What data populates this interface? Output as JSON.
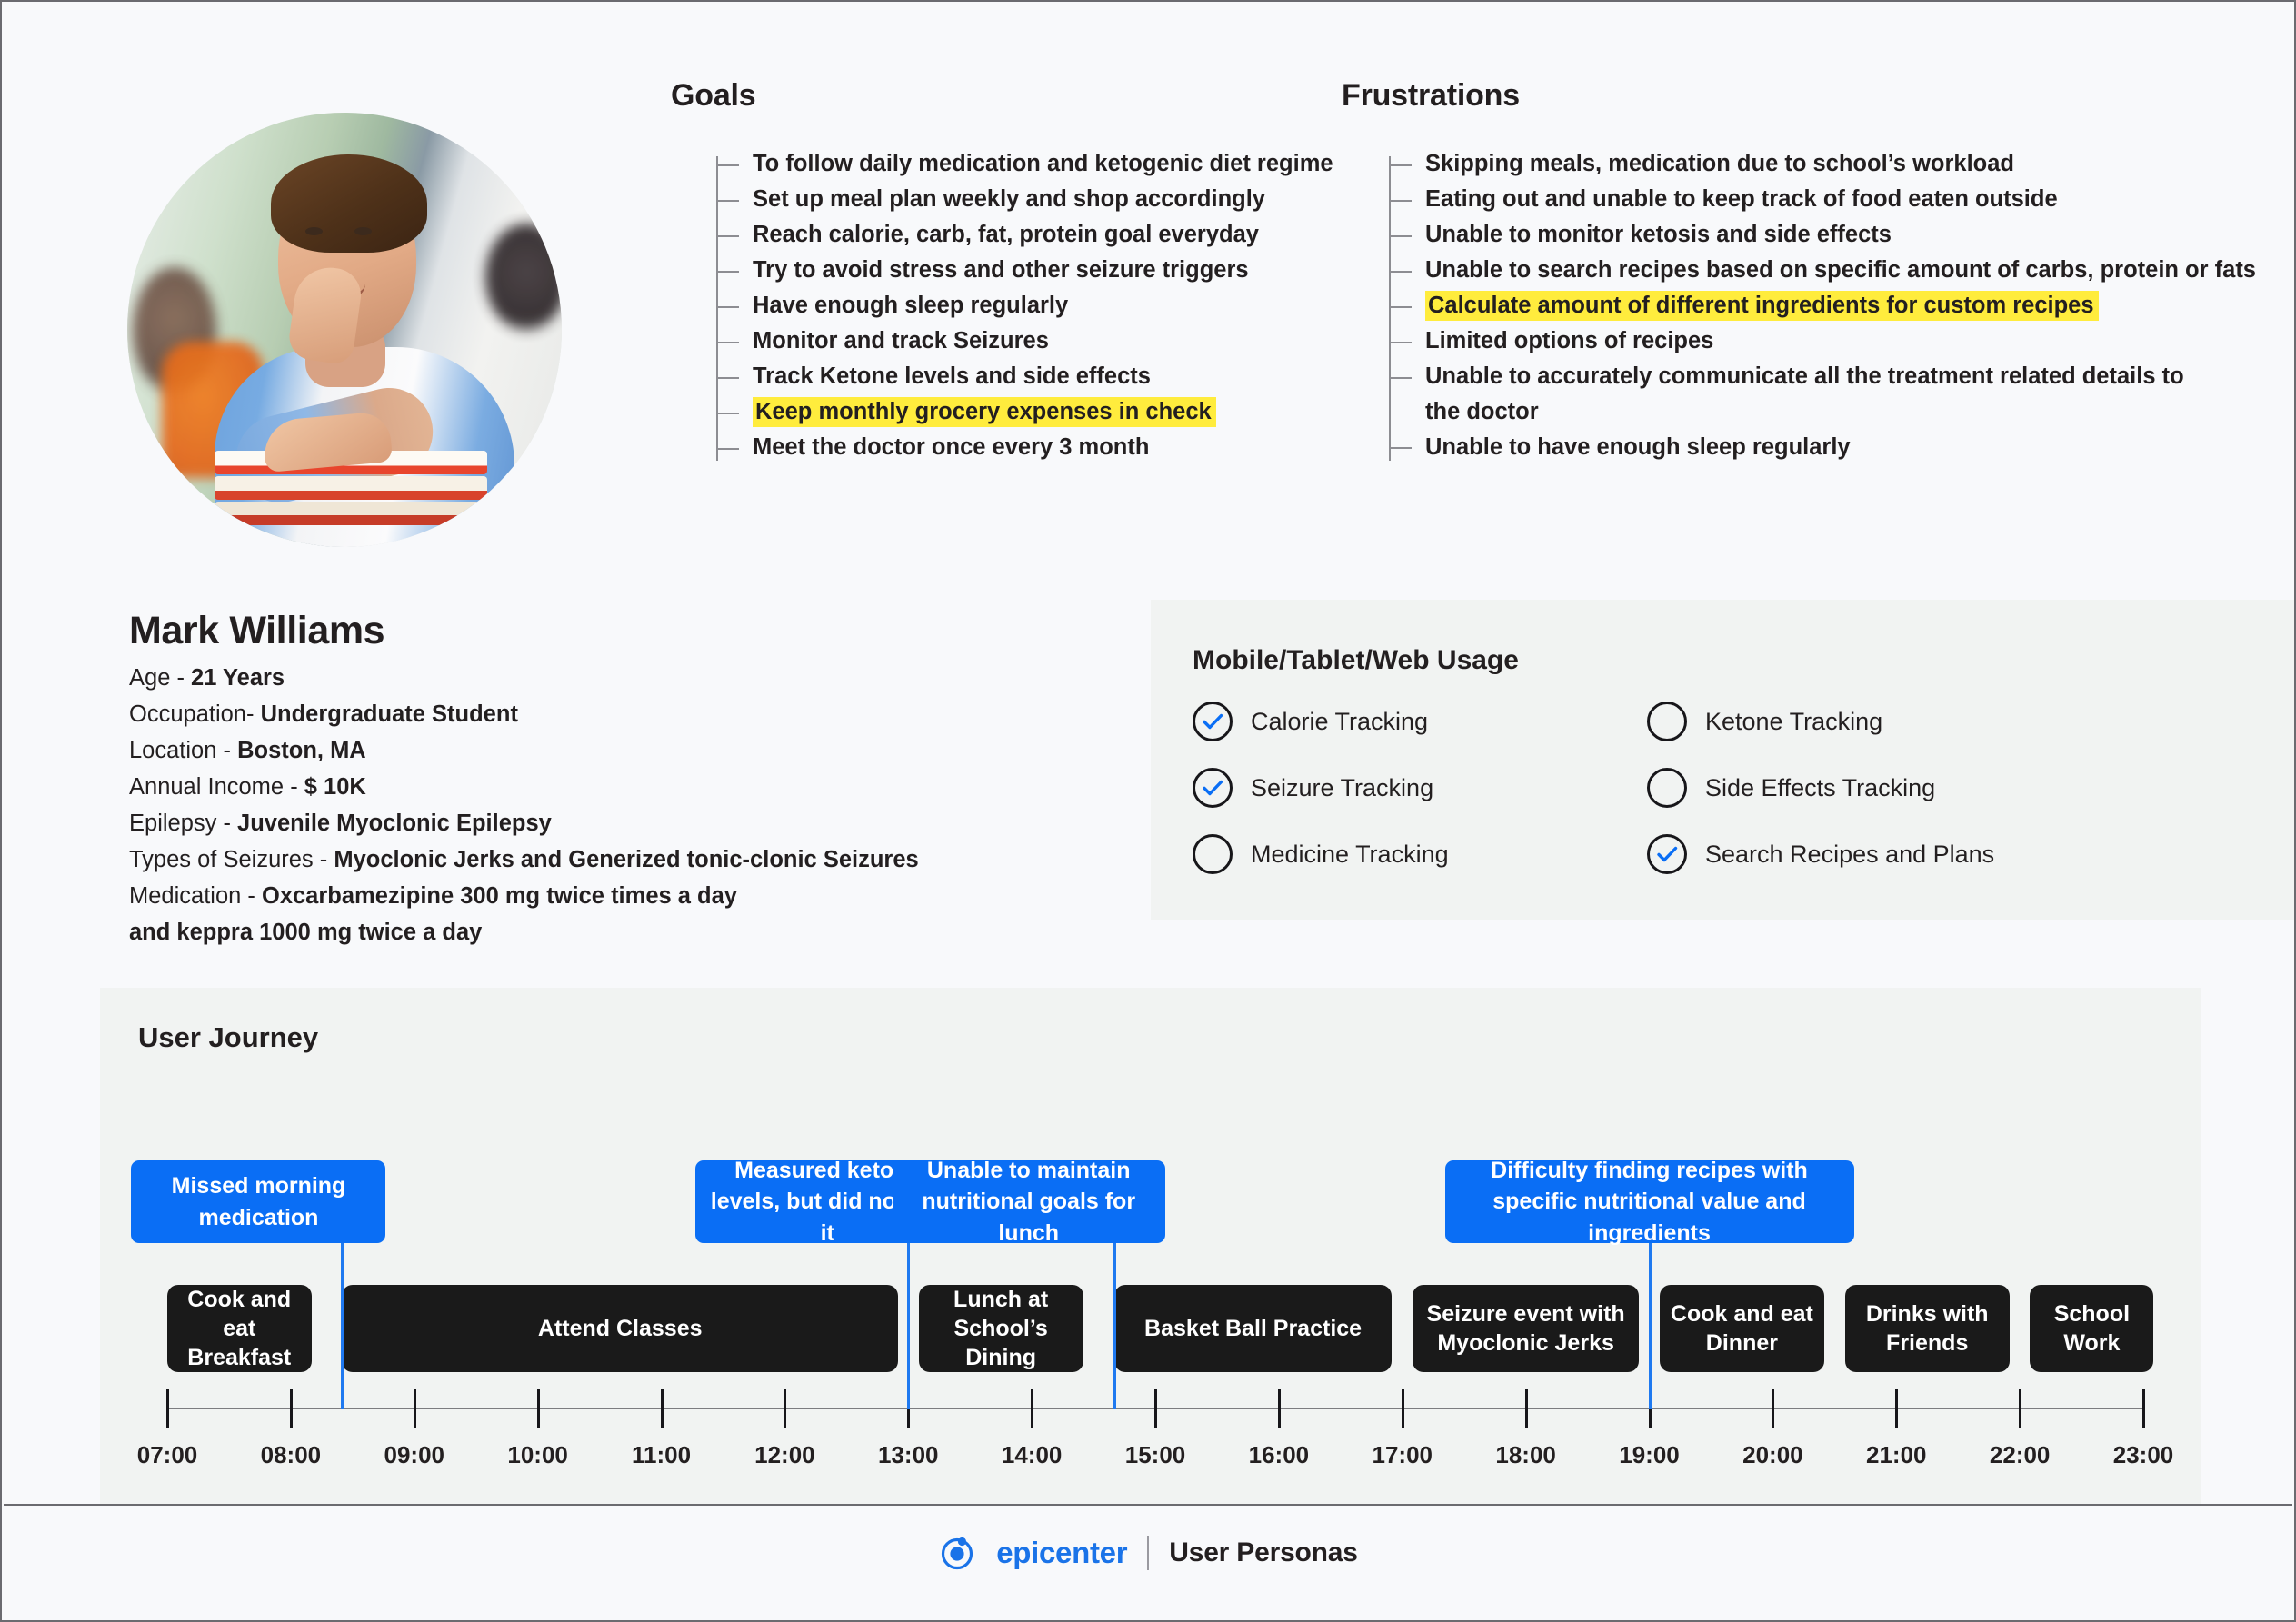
{
  "avatar": {
    "alt": "portrait-photo-of-young-man-with-books"
  },
  "goals": {
    "title": "Goals",
    "items": [
      {
        "text": "To follow daily medication and ketogenic diet regime",
        "highlight": false
      },
      {
        "text": "Set up meal plan weekly and shop accordingly",
        "highlight": false
      },
      {
        "text": "Reach calorie, carb, fat, protein goal everyday",
        "highlight": false
      },
      {
        "text": "Try to avoid stress and other seizure triggers",
        "highlight": false
      },
      {
        "text": "Have enough sleep regularly",
        "highlight": false
      },
      {
        "text": "Monitor and track Seizures",
        "highlight": false
      },
      {
        "text": "Track Ketone levels and side effects",
        "highlight": false
      },
      {
        "text": "Keep monthly grocery expenses in check",
        "highlight": true
      },
      {
        "text": "Meet the doctor once every 3 month",
        "highlight": false
      }
    ]
  },
  "frustrations": {
    "title": "Frustrations",
    "items": [
      {
        "text": "Skipping meals, medication due to school’s workload",
        "highlight": false
      },
      {
        "text": "Eating out and unable to keep track of food eaten outside",
        "highlight": false
      },
      {
        "text": "Unable to monitor ketosis and side effects",
        "highlight": false
      },
      {
        "text": "Unable to search recipes based on specific amount of carbs, protein or fats",
        "highlight": false
      },
      {
        "text": "Calculate amount of different ingredients for custom recipes",
        "highlight": true
      },
      {
        "text": "Limited options of recipes",
        "highlight": false
      },
      {
        "text": "Unable to accurately communicate all the treatment related details to",
        "highlight": false
      },
      {
        "text": "the doctor",
        "highlight": false,
        "continuation": true
      },
      {
        "text": "Unable to have enough sleep regularly",
        "highlight": false
      }
    ]
  },
  "persona": {
    "name": "Mark Williams",
    "fields": [
      {
        "label": "Age - ",
        "value": "21 Years"
      },
      {
        "label": "Occupation- ",
        "value": "Undergraduate Student"
      },
      {
        "label": "Location - ",
        "value": "Boston, MA"
      },
      {
        "label": "Annual Income - ",
        "value": "$ 10K"
      },
      {
        "label": "Epilepsy - ",
        "value": "Juvenile Myoclonic Epilepsy"
      },
      {
        "label": "Types of Seizures - ",
        "value": "Myoclonic Jerks and Generized tonic-clonic Seizures"
      },
      {
        "label": "Medication - ",
        "value": "Oxcarbamezipine 300 mg twice times a day"
      },
      {
        "label": "",
        "value": "and keppra 1000 mg twice a day"
      }
    ]
  },
  "usage": {
    "title": "Mobile/Tablet/Web Usage",
    "items": [
      {
        "label": "Calorie Tracking",
        "checked": true
      },
      {
        "label": "Ketone Tracking",
        "checked": false
      },
      {
        "label": "Seizure Tracking",
        "checked": true
      },
      {
        "label": "Side Effects Tracking",
        "checked": false
      },
      {
        "label": "Medicine Tracking",
        "checked": false
      },
      {
        "label": "Search Recipes and Plans",
        "checked": true
      }
    ]
  },
  "journey": {
    "title": "User Journey",
    "activities": [
      {
        "label": "Cook and eat Breakfast",
        "start": "07:00",
        "end": "08:10"
      },
      {
        "label": "Attend Classes",
        "start": "08:25",
        "end": "12:55"
      },
      {
        "label": "Lunch at School’s Dining",
        "start": "13:05",
        "end": "14:25"
      },
      {
        "label": "Basket Ball Practice",
        "start": "14:40",
        "end": "16:55"
      },
      {
        "label": "Seizure event with Myoclonic Jerks",
        "start": "17:05",
        "end": "18:55"
      },
      {
        "label": "Cook and eat Dinner",
        "start": "19:05",
        "end": "20:25"
      },
      {
        "label": "Drinks with Friends",
        "start": "20:35",
        "end": "21:55"
      },
      {
        "label": "School Work",
        "start": "22:05",
        "end": "23:05"
      }
    ],
    "callouts": [
      {
        "label": "Missed morning medication",
        "at": "08:25"
      },
      {
        "label": "Measured ketone levels, but did not log it",
        "at": "13:00"
      },
      {
        "label": "Unable to maintain nutritional goals for lunch",
        "at": "14:40"
      },
      {
        "label": "Difficulty finding recipes with specific nutritional value and ingredients",
        "at": "19:00"
      }
    ],
    "axis_labels": [
      "07:00",
      "08:00",
      "09:00",
      "10:00",
      "11:00",
      "12:00",
      "13:00",
      "14:00",
      "15:00",
      "16:00",
      "17:00",
      "18:00",
      "19:00",
      "20:00",
      "21:00",
      "22:00",
      "23:00"
    ]
  },
  "footer": {
    "brand": "epicenter",
    "subtitle": "User Personas"
  },
  "colors": {
    "accent_blue": "#0a6ef5",
    "logo_blue": "#1a73e8",
    "highlight_yellow": "#ffec3d",
    "activity_dark": "#1a1a1a",
    "panel_gray": "#f1f3f2",
    "page_bg": "#f8f9fb"
  }
}
